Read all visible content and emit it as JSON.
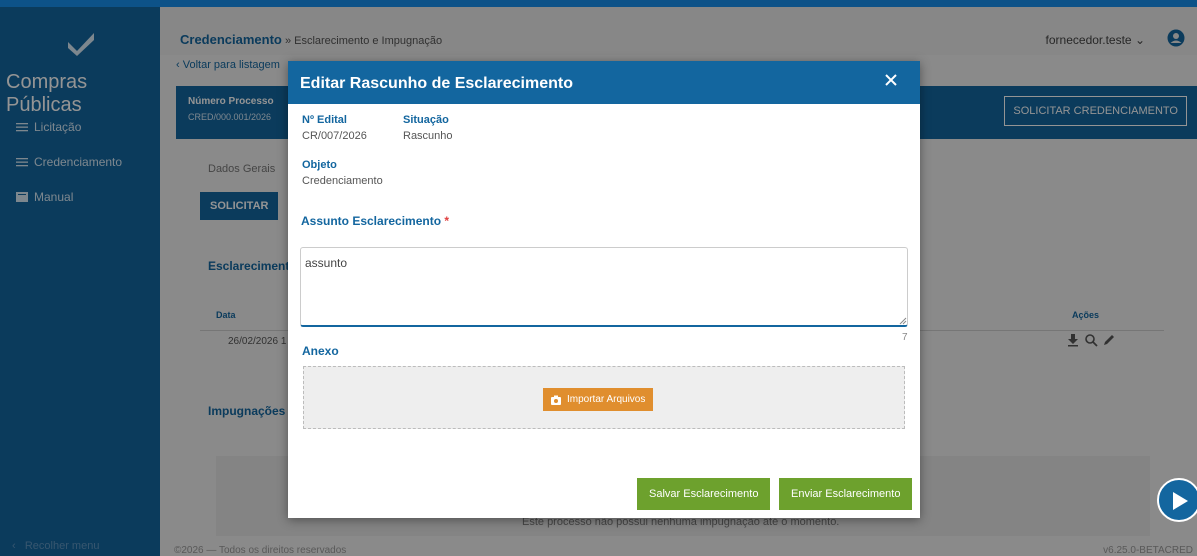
{
  "app": {
    "name": "Compras Públicas"
  },
  "sidebar": {
    "items": [
      {
        "label": "Licitação",
        "icon": "list-icon"
      },
      {
        "label": "Credenciamento",
        "icon": "list-icon"
      },
      {
        "label": "Manual",
        "icon": "book-icon"
      }
    ],
    "collapse_label": "Recolher menu"
  },
  "header": {
    "module": "Credenciamento",
    "breadcrumb_rest": "» Esclarecimento e Impugnação",
    "user": "fornecedor.teste"
  },
  "page": {
    "back_link": "Voltar para listagem",
    "process_label": "Número Processo",
    "process_value": "CRED/000.001/2026",
    "solicit_cred_button": "SOLICITAR CREDENCIAMENTO",
    "tab_general": "Dados Gerais",
    "solicit_button": "SOLICITAR",
    "section_clarifications": "Esclarecimentos",
    "table_col_date": "Data",
    "table_col_actions": "Ações",
    "row_date": "26/02/2026 1",
    "section_challenges": "Impugnações",
    "no_challenges_msg": "Este processo não possui nenhuma impugnação até o momento.",
    "footer_copy": "©2026 — Todos os direitos reservados",
    "version": "v6.25.0-BETACRED"
  },
  "modal": {
    "title": "Editar Rascunho de Esclarecimento",
    "edital_label": "Nº Edital",
    "edital_value": "CR/007/2026",
    "status_label": "Situação",
    "status_value": "Rascunho",
    "object_label": "Objeto",
    "object_value": "Credenciamento",
    "subject_label": "Assunto Esclarecimento",
    "required_mark": "*",
    "subject_value": "assunto",
    "char_count": "7",
    "annex_label": "Anexo",
    "import_button": "Importar Arquivos",
    "save_button": "Salvar Esclarecimento",
    "send_button": "Enviar Esclarecimento"
  },
  "colors": {
    "primary": "#13669f",
    "accent_orange": "#e08e2e",
    "accent_green": "#6da12d"
  }
}
